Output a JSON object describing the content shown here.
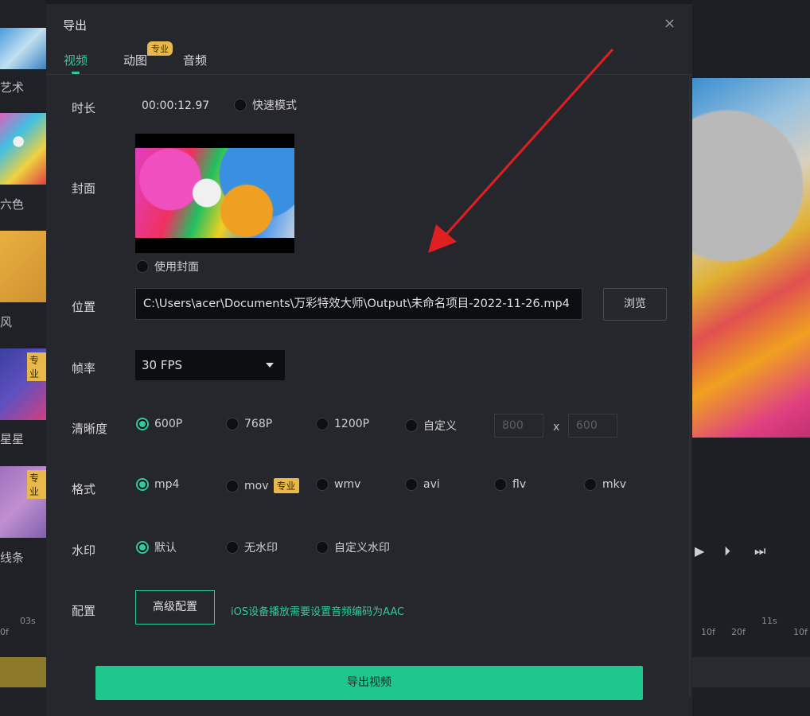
{
  "background": {
    "left_labels": [
      "艺术",
      "六色",
      "风",
      "星星",
      "线条"
    ],
    "left_badges": [
      "专业",
      "专业"
    ],
    "ruler_left": [
      "0f",
      "03s"
    ],
    "ruler_right": [
      "10f",
      "20f",
      "11s",
      "10f"
    ]
  },
  "dialog": {
    "title": "导出",
    "close": "×",
    "tabs": [
      {
        "label": "视频",
        "active": true
      },
      {
        "label": "动图",
        "badge": "专业"
      },
      {
        "label": "音频"
      }
    ],
    "duration": {
      "label": "时长",
      "value": "00:00:12.97",
      "fast_mode": "快速模式"
    },
    "cover": {
      "label": "封面",
      "use_cover": "使用封面"
    },
    "location": {
      "label": "位置",
      "path": "C:\\Users\\acer\\Documents\\万彩特效大师\\Output\\未命名项目-2022-11-26.mp4",
      "browse": "浏览"
    },
    "fps": {
      "label": "帧率",
      "value": "30 FPS"
    },
    "resolution": {
      "label": "清晰度",
      "options": [
        "600P",
        "768P",
        "1200P",
        "自定义"
      ],
      "selected": "600P",
      "width_placeholder": "800",
      "height_placeholder": "600",
      "times": "x"
    },
    "format": {
      "label": "格式",
      "options": [
        "mp4",
        "mov",
        "wmv",
        "avi",
        "flv",
        "mkv"
      ],
      "selected": "mp4",
      "pro_badge": "专业"
    },
    "watermark": {
      "label": "水印",
      "options": [
        "默认",
        "无水印",
        "自定义水印"
      ],
      "selected": "默认"
    },
    "config": {
      "label": "配置",
      "advanced": "高级配置",
      "hint": "iOS设备播放需要设置音频编码为AAC"
    },
    "export_button": "导出视频"
  },
  "colors": {
    "accent": "#2ecc9a",
    "pro": "#e8b84a",
    "arrow": "#e02020"
  }
}
